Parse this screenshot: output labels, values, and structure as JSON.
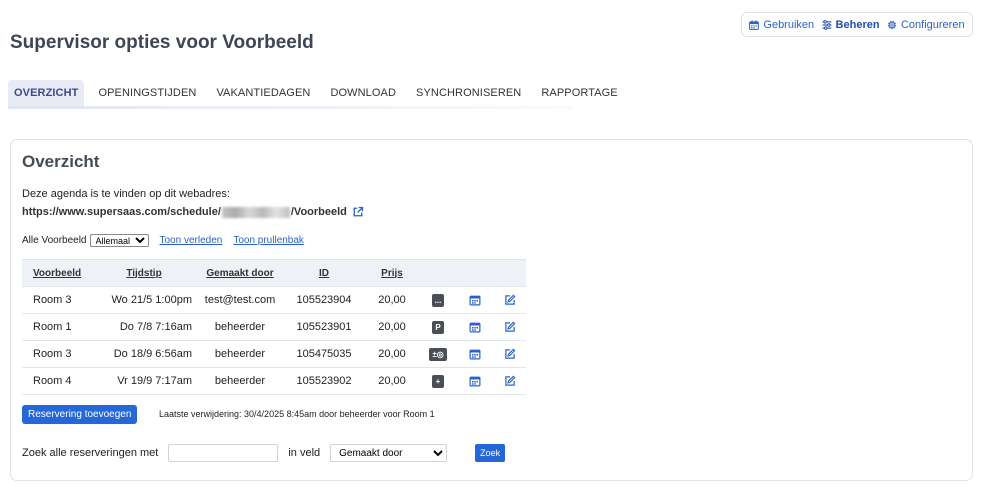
{
  "topnav": {
    "items": [
      {
        "label": "Gebruiken",
        "icon": "calendar-icon"
      },
      {
        "label": "Beheren",
        "icon": "sliders-icon",
        "active": true
      },
      {
        "label": "Configureren",
        "icon": "gear-icon"
      }
    ]
  },
  "page": {
    "title": "Supervisor opties voor Voorbeeld"
  },
  "tabs": [
    "OVERZICHT",
    "OPENINGSTIJDEN",
    "VAKANTIEDAGEN",
    "DOWNLOAD",
    "SYNCHRONISEREN",
    "RAPPORTAGE"
  ],
  "active_tab": "OVERZICHT",
  "overview": {
    "heading": "Overzicht",
    "intro": "Deze agenda is te vinden op dit webadres:",
    "url_prefix": "https://www.supersaas.com/schedule/",
    "url_suffix": "/Voorbeeld",
    "filter_label": "Alle Voorbeeld",
    "filter_selected": "Allemaal",
    "link_past": "Toon verleden",
    "link_trash": "Toon prullenbak"
  },
  "table": {
    "headers": [
      "Voorbeeld",
      "Tijdstip",
      "Gemaakt door",
      "ID",
      "Prijs"
    ],
    "rows": [
      {
        "resource": "Room 3",
        "time": "Wo 21/5 1:00pm",
        "by": "test@test.com",
        "id": "105523904",
        "price": "20,00",
        "badge": "..."
      },
      {
        "resource": "Room 1",
        "time": "Do 7/8 7:16am",
        "by": "beheerder",
        "id": "105523901",
        "price": "20,00",
        "badge": "P"
      },
      {
        "resource": "Room 3",
        "time": "Do 18/9 6:56am",
        "by": "beheerder",
        "id": "105475035",
        "price": "20,00",
        "badge": "±◎"
      },
      {
        "resource": "Room 4",
        "time": "Vr 19/9 7:17am",
        "by": "beheerder",
        "id": "105523902",
        "price": "20,00",
        "badge": "+"
      }
    ]
  },
  "actions": {
    "add_label": "Reservering toevoegen",
    "last_delete": "Laatste verwijdering: 30/4/2025 8:45am door beheerder voor Room 1"
  },
  "search": {
    "label": "Zoek alle reserveringen met",
    "value": "",
    "field_label": "in veld",
    "field_selected": "Gemaakt door",
    "button": "Zoek"
  },
  "colors": {
    "accent": "#2566d8",
    "link": "#2a62c9",
    "badge": "#4a4f57"
  }
}
